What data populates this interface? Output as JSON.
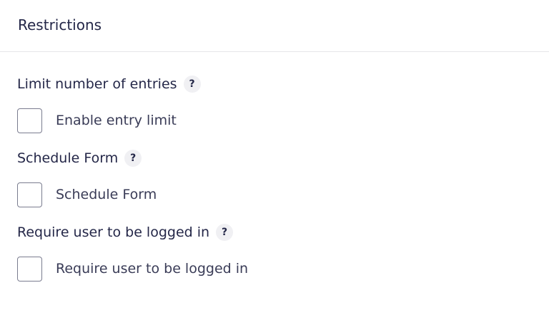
{
  "panel": {
    "title": "Restrictions"
  },
  "settings": [
    {
      "label": "Limit number of entries",
      "help": "?",
      "checkbox_label": "Enable entry limit",
      "checked": false
    },
    {
      "label": "Schedule Form",
      "help": "?",
      "checkbox_label": "Schedule Form",
      "checked": false
    },
    {
      "label": "Require user to be logged in",
      "help": "?",
      "checkbox_label": "Require user to be logged in",
      "checked": false
    }
  ]
}
